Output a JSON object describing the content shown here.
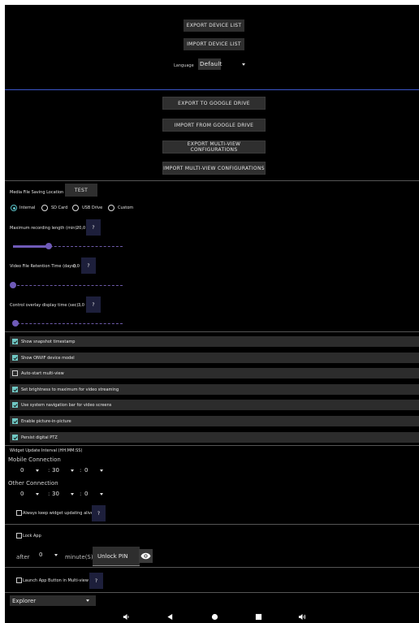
{
  "device_list": {
    "export_label": "EXPORT DEVICE LIST",
    "import_label": "IMPORT DEVICE LIST",
    "language_label": "Language",
    "language_value": "Default"
  },
  "drive": {
    "export_google": "EXPORT TO GOOGLE DRIVE",
    "import_google": "IMPORT FROM GOOGLE DRIVE",
    "export_multiview": "EXPORT MULTI-VIEW CONFIGURATIONS",
    "import_multiview": "IMPORT MULTI-VIEW CONFIGURATIONS"
  },
  "media": {
    "title": "Media File Saving Location",
    "test_label": "TEST",
    "options": [
      "Internal",
      "SD Card",
      "USB Drive",
      "Custom"
    ],
    "selected": "Internal"
  },
  "sliders": {
    "max_recording_label": "Maximum recording length (min):",
    "max_recording_value": "20,0",
    "max_recording_fraction": 0.32,
    "retention_label": "Video File Retention Time (days):",
    "retention_value": "0,0",
    "retention_fraction": 0.0,
    "overlay_label": "Control overlay display time (sec):",
    "overlay_value": "3,0",
    "overlay_fraction": 0.02,
    "help_label": "?"
  },
  "checkbox_rows": [
    {
      "label": "Show snapshot timestamp",
      "checked": true
    },
    {
      "label": "Show ONVIF device model",
      "checked": true
    },
    {
      "label": "Auto-start multi-view",
      "checked": false
    },
    {
      "label": "Set brightness to maximum for video streaming",
      "checked": true
    },
    {
      "label": "Use system navigation bar for video screens",
      "checked": true
    },
    {
      "label": "Enable picture-in-picture",
      "checked": true
    },
    {
      "label": "Persist digital PTZ",
      "checked": true
    }
  ],
  "widget": {
    "title": "Widget Update Interval (HH:MM:SS)",
    "mobile_label": "Mobile Connection",
    "other_label": "Other Connection",
    "mobile": {
      "h": "0",
      "m": "30",
      "s": "0"
    },
    "other": {
      "h": "0",
      "m": "30",
      "s": "0"
    },
    "colon": ":",
    "always_label": "Always keep widget updating alive",
    "help_label": "?"
  },
  "lock": {
    "label": "Lock App",
    "after_label": "after",
    "after_value": "0",
    "minutes_label": "minute(S)",
    "pin_label": "Unlock PIN"
  },
  "launch": {
    "label": "Launch App Button in Multi-view",
    "help_label": "?"
  },
  "explorer": {
    "value": "Explorer"
  },
  "colors": {
    "accent": "#6f5ab8",
    "checkbox": "#6fc7c3",
    "link_blue": "#4fb1e0",
    "divider_blue": "#3b56c9"
  }
}
